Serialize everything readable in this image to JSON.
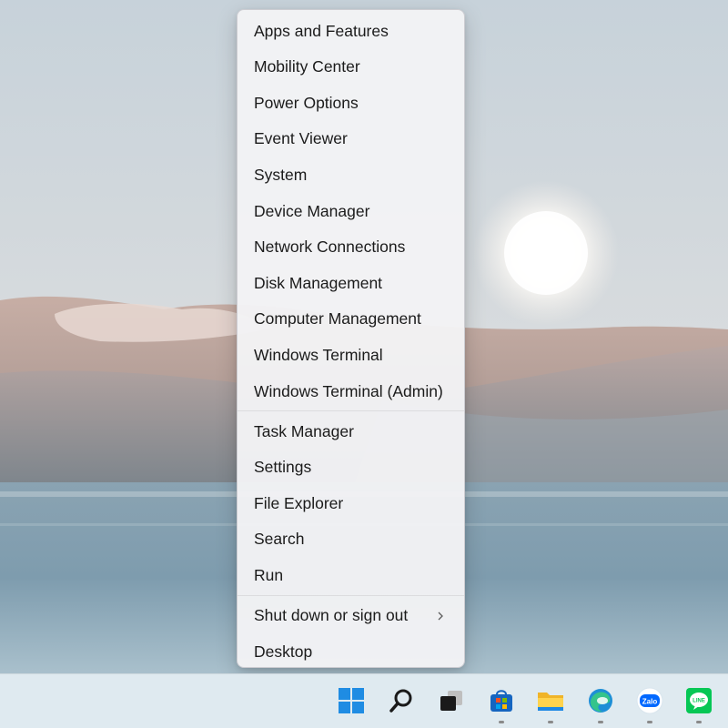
{
  "menu": {
    "groups": [
      [
        "Apps and Features",
        "Mobility Center",
        "Power Options",
        "Event Viewer",
        "System",
        "Device Manager",
        "Network Connections",
        "Disk Management",
        "Computer Management",
        "Windows Terminal",
        "Windows Terminal (Admin)"
      ],
      [
        "Task Manager",
        "Settings",
        "File Explorer",
        "Search",
        "Run"
      ],
      [
        "Shut down or sign out",
        "Desktop"
      ]
    ],
    "submenu_item": "Shut down or sign out"
  },
  "taskbar": {
    "icons": [
      {
        "name": "start-icon",
        "running": false
      },
      {
        "name": "search-icon",
        "running": false
      },
      {
        "name": "task-view-icon",
        "running": false
      },
      {
        "name": "microsoft-store-icon",
        "running": true
      },
      {
        "name": "file-explorer-icon",
        "running": true
      },
      {
        "name": "edge-icon",
        "running": true
      },
      {
        "name": "zalo-icon",
        "running": true,
        "label": "Zalo"
      },
      {
        "name": "line-icon",
        "running": true,
        "label": "LINE"
      }
    ]
  },
  "colors": {
    "accent": "#0078d4",
    "menu_bg": "#f3f3f5",
    "taskbar_bg": "#dfeaf0"
  }
}
